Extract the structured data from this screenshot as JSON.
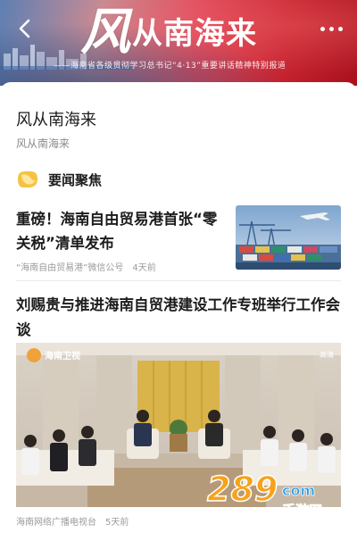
{
  "banner": {
    "title_big": "风",
    "title_rest": "从南海来",
    "subtitle": "——海南省各级贯彻学习总书记“4·13”重要讲话精神特别报道",
    "back_icon": "back-arrow-icon",
    "more_icon": "more-dots-icon"
  },
  "page": {
    "title": "风从南海来",
    "subtitle": "风从南海来"
  },
  "section": {
    "title": "要闻聚焦",
    "icon": "news-focus-icon"
  },
  "articles": [
    {
      "title": "重磅！海南自由贸易港首张“零关税”清单发布",
      "source": "“海南自由贸易港”微信公号",
      "time": "4天前",
      "thumb": "port-container-photo"
    },
    {
      "title": "刘赐贵与推进海南自贸港建设工作专班举行工作会谈",
      "source": "海南网络广播电视台",
      "time": "5天前",
      "photo": "meeting-room-photo",
      "photo_logo": "海南卫视",
      "photo_corner": "高清"
    }
  ],
  "watermark": {
    "number": "289",
    "suffix": "com",
    "text": "手游网"
  },
  "colors": {
    "accent_yellow": "#f5c242",
    "banner_red": "#c4212d",
    "meta_gray": "#9a9a9a"
  }
}
